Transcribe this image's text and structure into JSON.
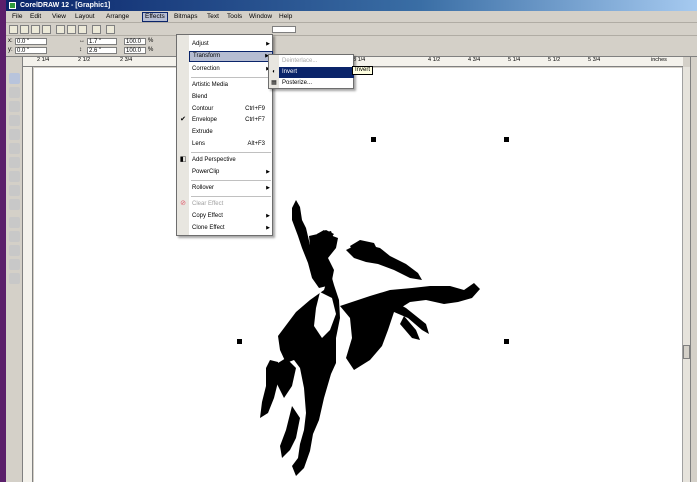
{
  "window": {
    "title": "CorelDRAW 12 - [Graphic1]"
  },
  "menubar": [
    {
      "label": "File"
    },
    {
      "label": "Edit"
    },
    {
      "label": "View"
    },
    {
      "label": "Layout"
    },
    {
      "label": "Arrange"
    },
    {
      "label": "Effects",
      "active": true
    },
    {
      "label": "Bitmaps"
    },
    {
      "label": "Text"
    },
    {
      "label": "Tools"
    },
    {
      "label": "Window"
    },
    {
      "label": "Help"
    }
  ],
  "propertybar": {
    "x": "0.0 \"",
    "y": "0.0 \"",
    "width": "1.7 \"",
    "height": "2.6 \"",
    "scale_x": "100.0",
    "scale_y": "100.0",
    "pct": "%"
  },
  "ruler_h_ticks": [
    "2 1/4",
    "2 1/2",
    "2 3/4",
    "3 1/4",
    "4 1/2",
    "4 3/4",
    "5 1/4",
    "5 1/2",
    "5 3/4",
    "inches"
  ],
  "effects_menu": {
    "items": [
      {
        "label": "Adjust",
        "submenu": true
      },
      {
        "label": "Transform",
        "submenu": true,
        "highlight": true
      },
      {
        "label": "Correction",
        "submenu": true
      },
      {
        "label": "Artistic Media"
      },
      {
        "label": "Blend"
      },
      {
        "label": "Contour",
        "shortcut": "Ctrl+F9"
      },
      {
        "label": "Envelope",
        "shortcut": "Ctrl+F7",
        "checked": true
      },
      {
        "label": "Extrude"
      },
      {
        "label": "Lens",
        "shortcut": "Alt+F3"
      },
      {
        "label": "Add Perspective"
      },
      {
        "label": "PowerClip",
        "submenu": true
      },
      {
        "label": "Rollover",
        "submenu": true
      },
      {
        "label": "Clear Effect",
        "disabled": true
      },
      {
        "label": "Copy Effect",
        "submenu": true
      },
      {
        "label": "Clone Effect",
        "submenu": true
      }
    ]
  },
  "transform_submenu": {
    "items": [
      {
        "label": "Deinterlace...",
        "disabled": true
      },
      {
        "label": "Invert",
        "highlight": true
      },
      {
        "label": "Posterize..."
      }
    ]
  },
  "tooltip": "Invert",
  "icons": {
    "check": "checkmark-icon",
    "perspective": "perspective-icon",
    "clear_effect": "clear-effect-icon",
    "invert": "invert-icon",
    "posterize": "posterize-icon"
  },
  "colors": {
    "title_start": "#0a246a",
    "menu_highlight": "#b6bdd2",
    "submenu_highlight": "#0a246a",
    "frame": "#5b1f6b"
  }
}
